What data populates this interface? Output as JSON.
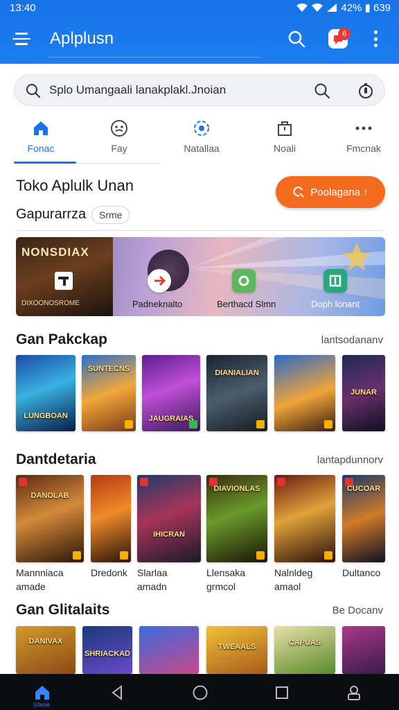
{
  "status": {
    "time": "13:40",
    "battery": "42% ▮ 639"
  },
  "appbar": {
    "title": "Aplplusn",
    "notification_count": "6"
  },
  "search": {
    "text": "Splo Umangaali lanakplakl.Jnoian"
  },
  "tabs": [
    {
      "label": "Fonac",
      "active": true
    },
    {
      "label": "Fay"
    },
    {
      "label": "Natallaa"
    },
    {
      "label": "Noali"
    },
    {
      "label": "Fmcnak"
    }
  ],
  "store": {
    "title": "Toko Aplulk Unan",
    "subtitle": "Gapurarrza",
    "chip": "Srme",
    "cta_label": "Poolagana ↑"
  },
  "banner": {
    "game_logo": "NONSDIAX",
    "game_caption": "DIXOONOSROME",
    "items": [
      {
        "label": "Padneknalto"
      },
      {
        "label": "Berthacd Slmn"
      },
      {
        "label": "Doph lonant"
      }
    ]
  },
  "sections": [
    {
      "title": "Gan Pakckap",
      "link": "lantsodananv"
    },
    {
      "title": "Dantdetaria",
      "link": "lantapdunnorv"
    },
    {
      "title": "Gan Glitalaits",
      "link": "Be Docanv"
    }
  ],
  "row1_cards": [
    {
      "caption": "LUNGBOAN"
    },
    {
      "caption": "SUNTECNS"
    },
    {
      "caption": "JAUGRAIAS"
    },
    {
      "caption": "DIANIALIAN"
    },
    {
      "caption": ""
    },
    {
      "caption": "JUNAR"
    }
  ],
  "row2_cards": [
    {
      "caption": "DANOLAB",
      "name1": "Mannniaca",
      "name2": "amade"
    },
    {
      "caption": "",
      "name1": "Dredonk",
      "name2": ""
    },
    {
      "caption": "IHICRAN",
      "name1": "Slarlaa",
      "name2": "amadn"
    },
    {
      "caption": "DIAVIONLAS",
      "name1": "Llensaka",
      "name2": "grmcol"
    },
    {
      "caption": "",
      "name1": "Nalnldeg",
      "name2": "amaol"
    },
    {
      "caption": "CUCOAR",
      "name1": "Dultanco",
      "name2": ""
    }
  ],
  "row3_cards": [
    {
      "caption": "DANIVAX"
    },
    {
      "caption": "SHRIACKAD"
    },
    {
      "caption": ""
    },
    {
      "caption": "TWEAALS"
    },
    {
      "caption": "CAPUAS"
    },
    {
      "caption": ""
    }
  ],
  "navbar": {
    "home_label": "Gfame"
  },
  "colors": {
    "primary": "#1b74e4",
    "accent": "#f26b1f",
    "navbar": "#0c0d10"
  }
}
